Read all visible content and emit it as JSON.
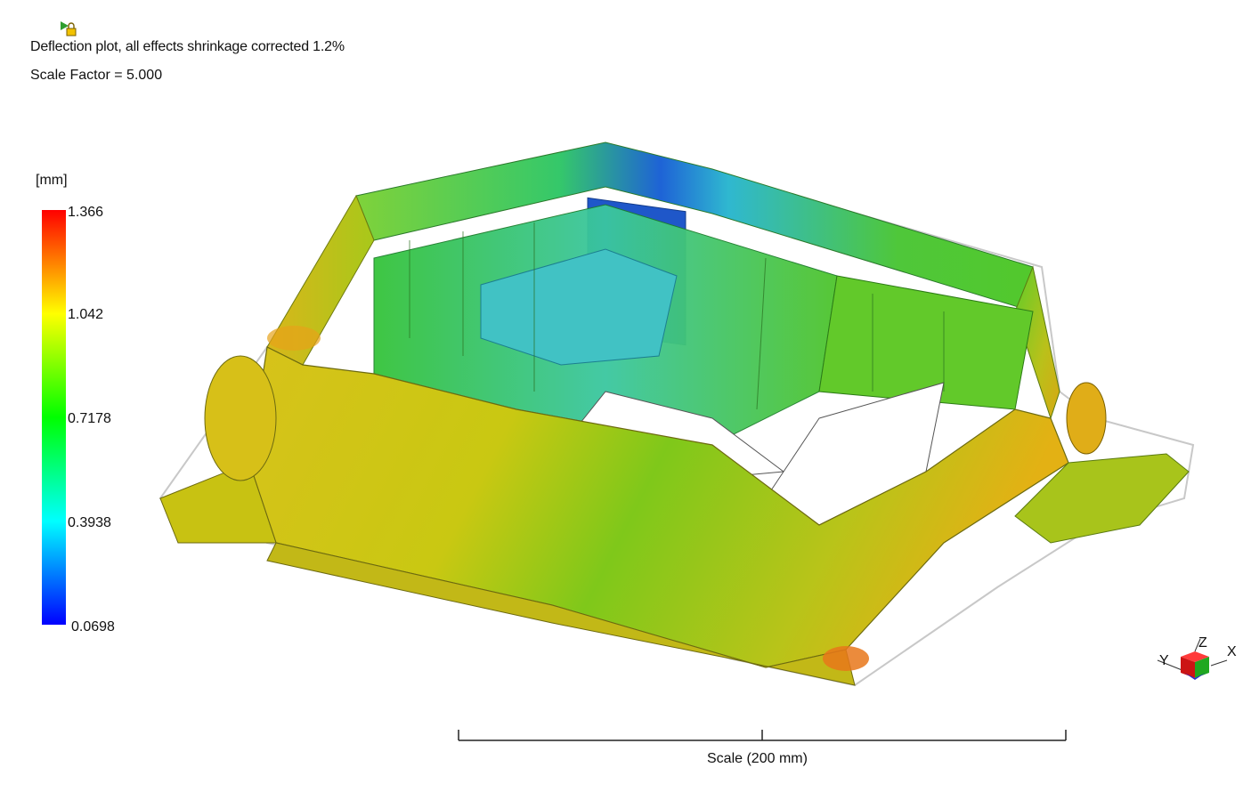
{
  "plot": {
    "title": "Deflection plot, all effects shrinkage corrected 1.2%",
    "scale_factor": "Scale Factor = 5.000",
    "result_icon": "result-play-icon"
  },
  "legend": {
    "unit": "[mm]",
    "max": "1.366",
    "ticks": [
      "1.366",
      "1.042",
      "0.7178",
      "0.3938",
      "0.0698"
    ],
    "colors": [
      "#ff0000",
      "#ffff00",
      "#00ff00",
      "#00ffff",
      "#0000ff"
    ]
  },
  "scale_bar": {
    "label": "Scale (200 mm)"
  },
  "triad": {
    "axis_x": "X",
    "axis_y": "Y",
    "axis_z": "Z"
  },
  "model": {
    "name": "part-deflection-model"
  }
}
